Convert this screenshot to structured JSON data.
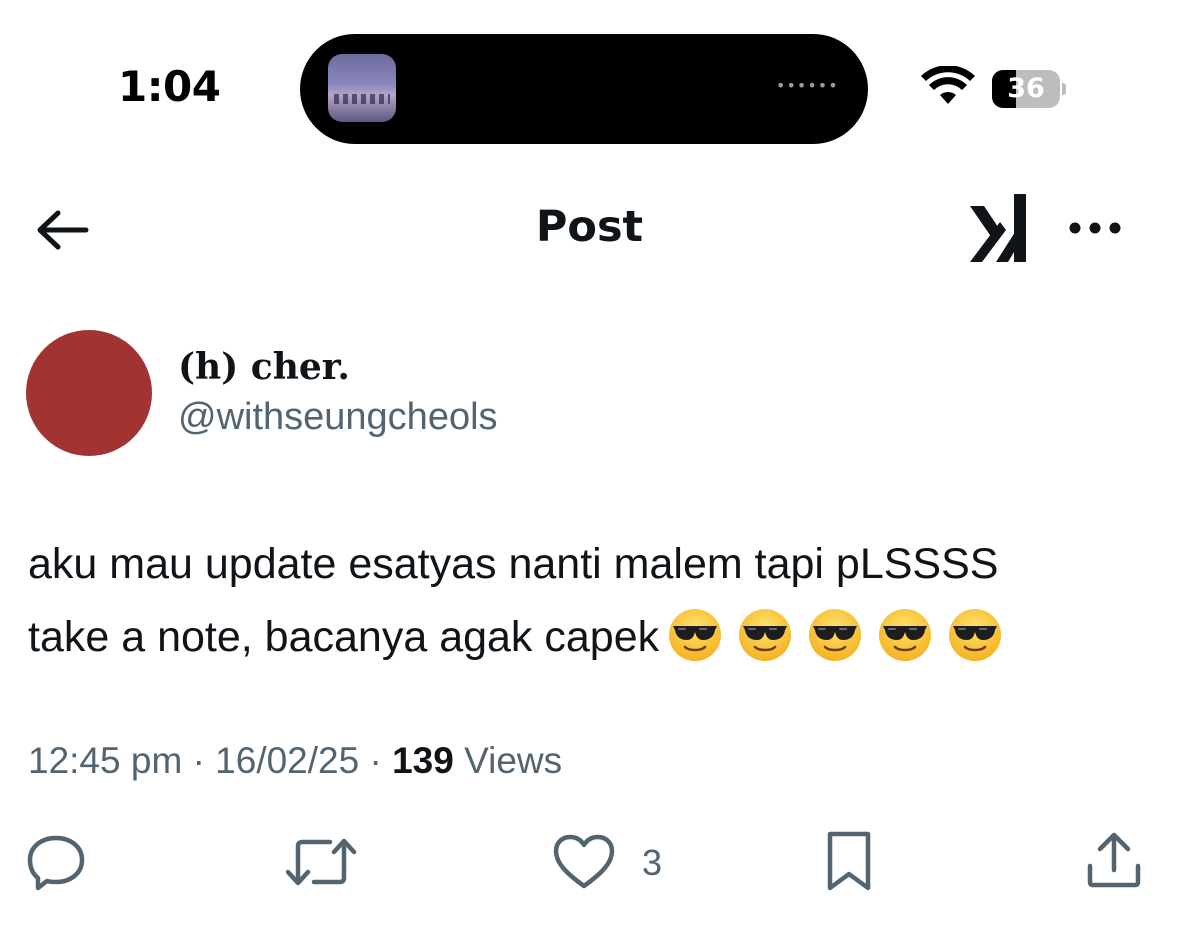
{
  "status_bar": {
    "time": "1:04",
    "battery_level": "36",
    "battery_fraction": 0.36,
    "island_dots": "••••••"
  },
  "nav": {
    "title": "Post",
    "icons": [
      "back-arrow-icon",
      "grok-icon",
      "more-icon"
    ]
  },
  "author": {
    "display_name": "(h) cher.",
    "handle": "@withseungcheols",
    "avatar_color": "#a23333"
  },
  "post": {
    "text_line_1": "aku mau update esatyas nanti malem tapi pLSSSS",
    "text_line_2": "take a note, bacanya agak capek",
    "emoji": [
      "😎",
      "😎",
      "😎",
      "😎",
      "😎"
    ],
    "time": "12:45 pm",
    "date": "16/02/25",
    "separator": "·",
    "views_count": "139",
    "views_label": "Views"
  },
  "actions": {
    "likes_count": "3",
    "icons": [
      "reply-icon",
      "repost-icon",
      "like-icon",
      "bookmark-icon",
      "share-icon"
    ]
  },
  "colors": {
    "text_primary": "#0f1419",
    "text_secondary": "#536471",
    "icon": "#536471"
  }
}
